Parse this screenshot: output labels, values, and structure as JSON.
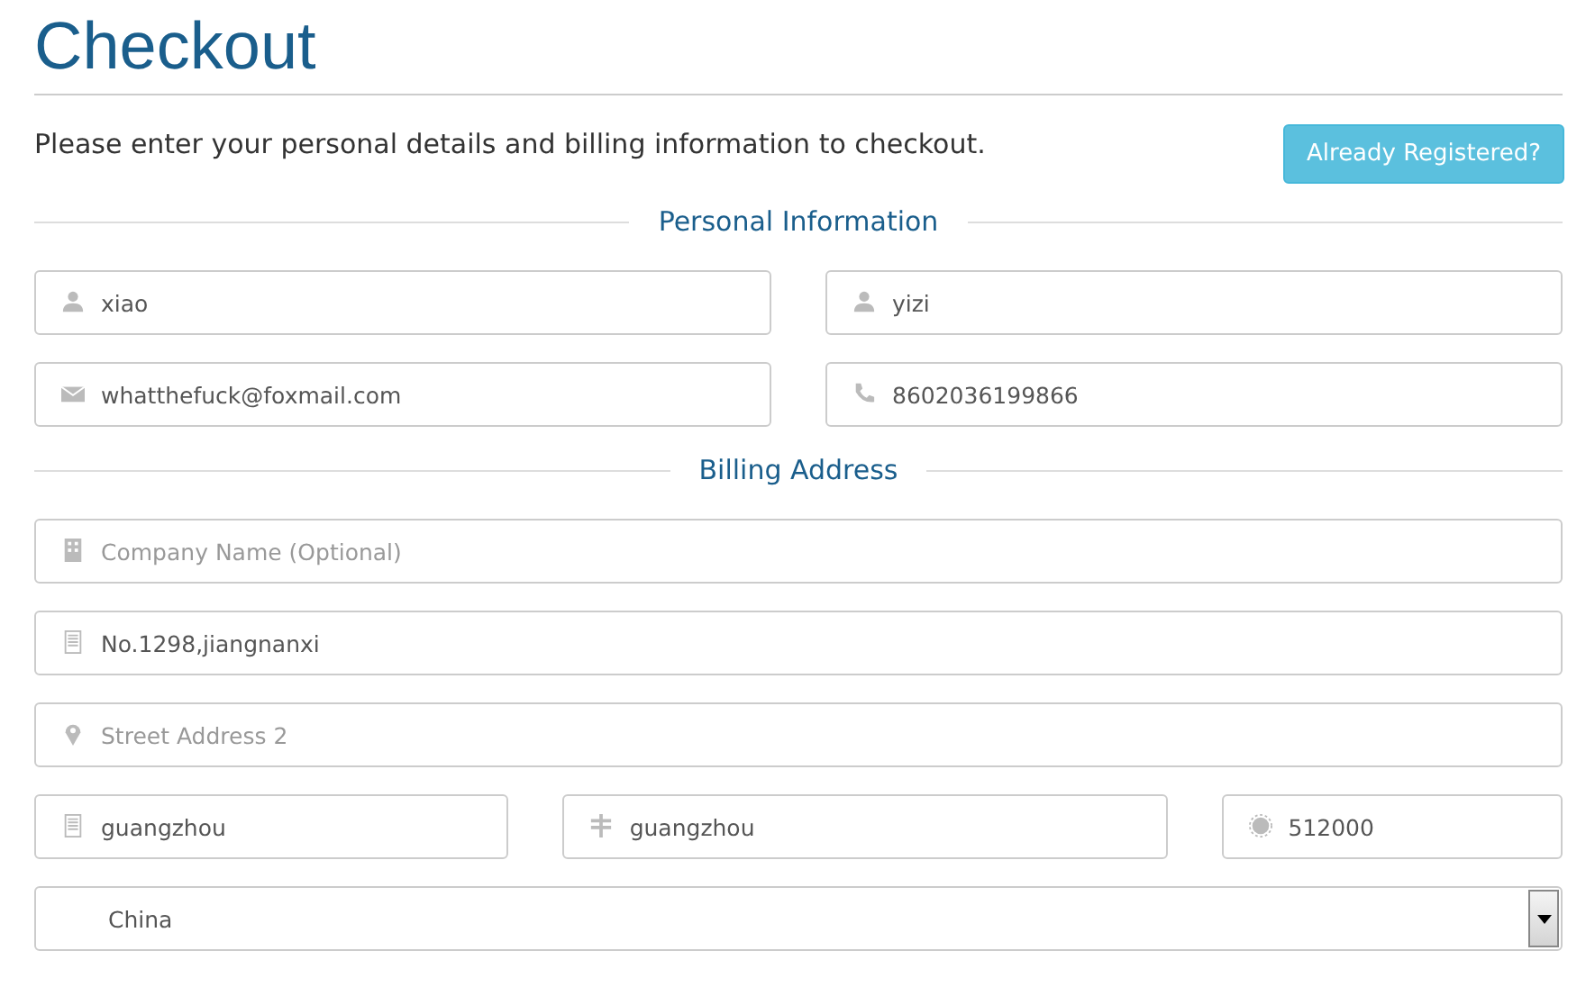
{
  "title": "Checkout",
  "intro": "Please enter your personal details and billing information to checkout.",
  "login_button": "Already Registered?",
  "sections": [
    {
      "heading": "Personal Information",
      "rows": [
        [
          {
            "kind": "user",
            "value": "xiao"
          },
          {
            "kind": "user",
            "value": "yizi"
          }
        ],
        [
          {
            "kind": "envelope",
            "value": "whatthefuck@foxmail.com"
          },
          {
            "kind": "phone",
            "value": "8602036199866"
          }
        ]
      ]
    },
    {
      "heading": "Billing Address",
      "rows": [
        [
          {
            "kind": "building",
            "placeholder": "Company Name (Optional)"
          }
        ],
        [
          {
            "kind": "page",
            "value": "No.1298,jiangnanxi"
          }
        ],
        [
          {
            "kind": "marker",
            "placeholder": "Street Address 2"
          }
        ],
        [
          {
            "kind": "page",
            "value": "guangzhou"
          },
          {
            "kind": "signpost",
            "value": "guangzhou"
          },
          {
            "kind": "badge",
            "value": "512000"
          }
        ]
      ]
    }
  ],
  "country_select": {
    "value": "China"
  }
}
